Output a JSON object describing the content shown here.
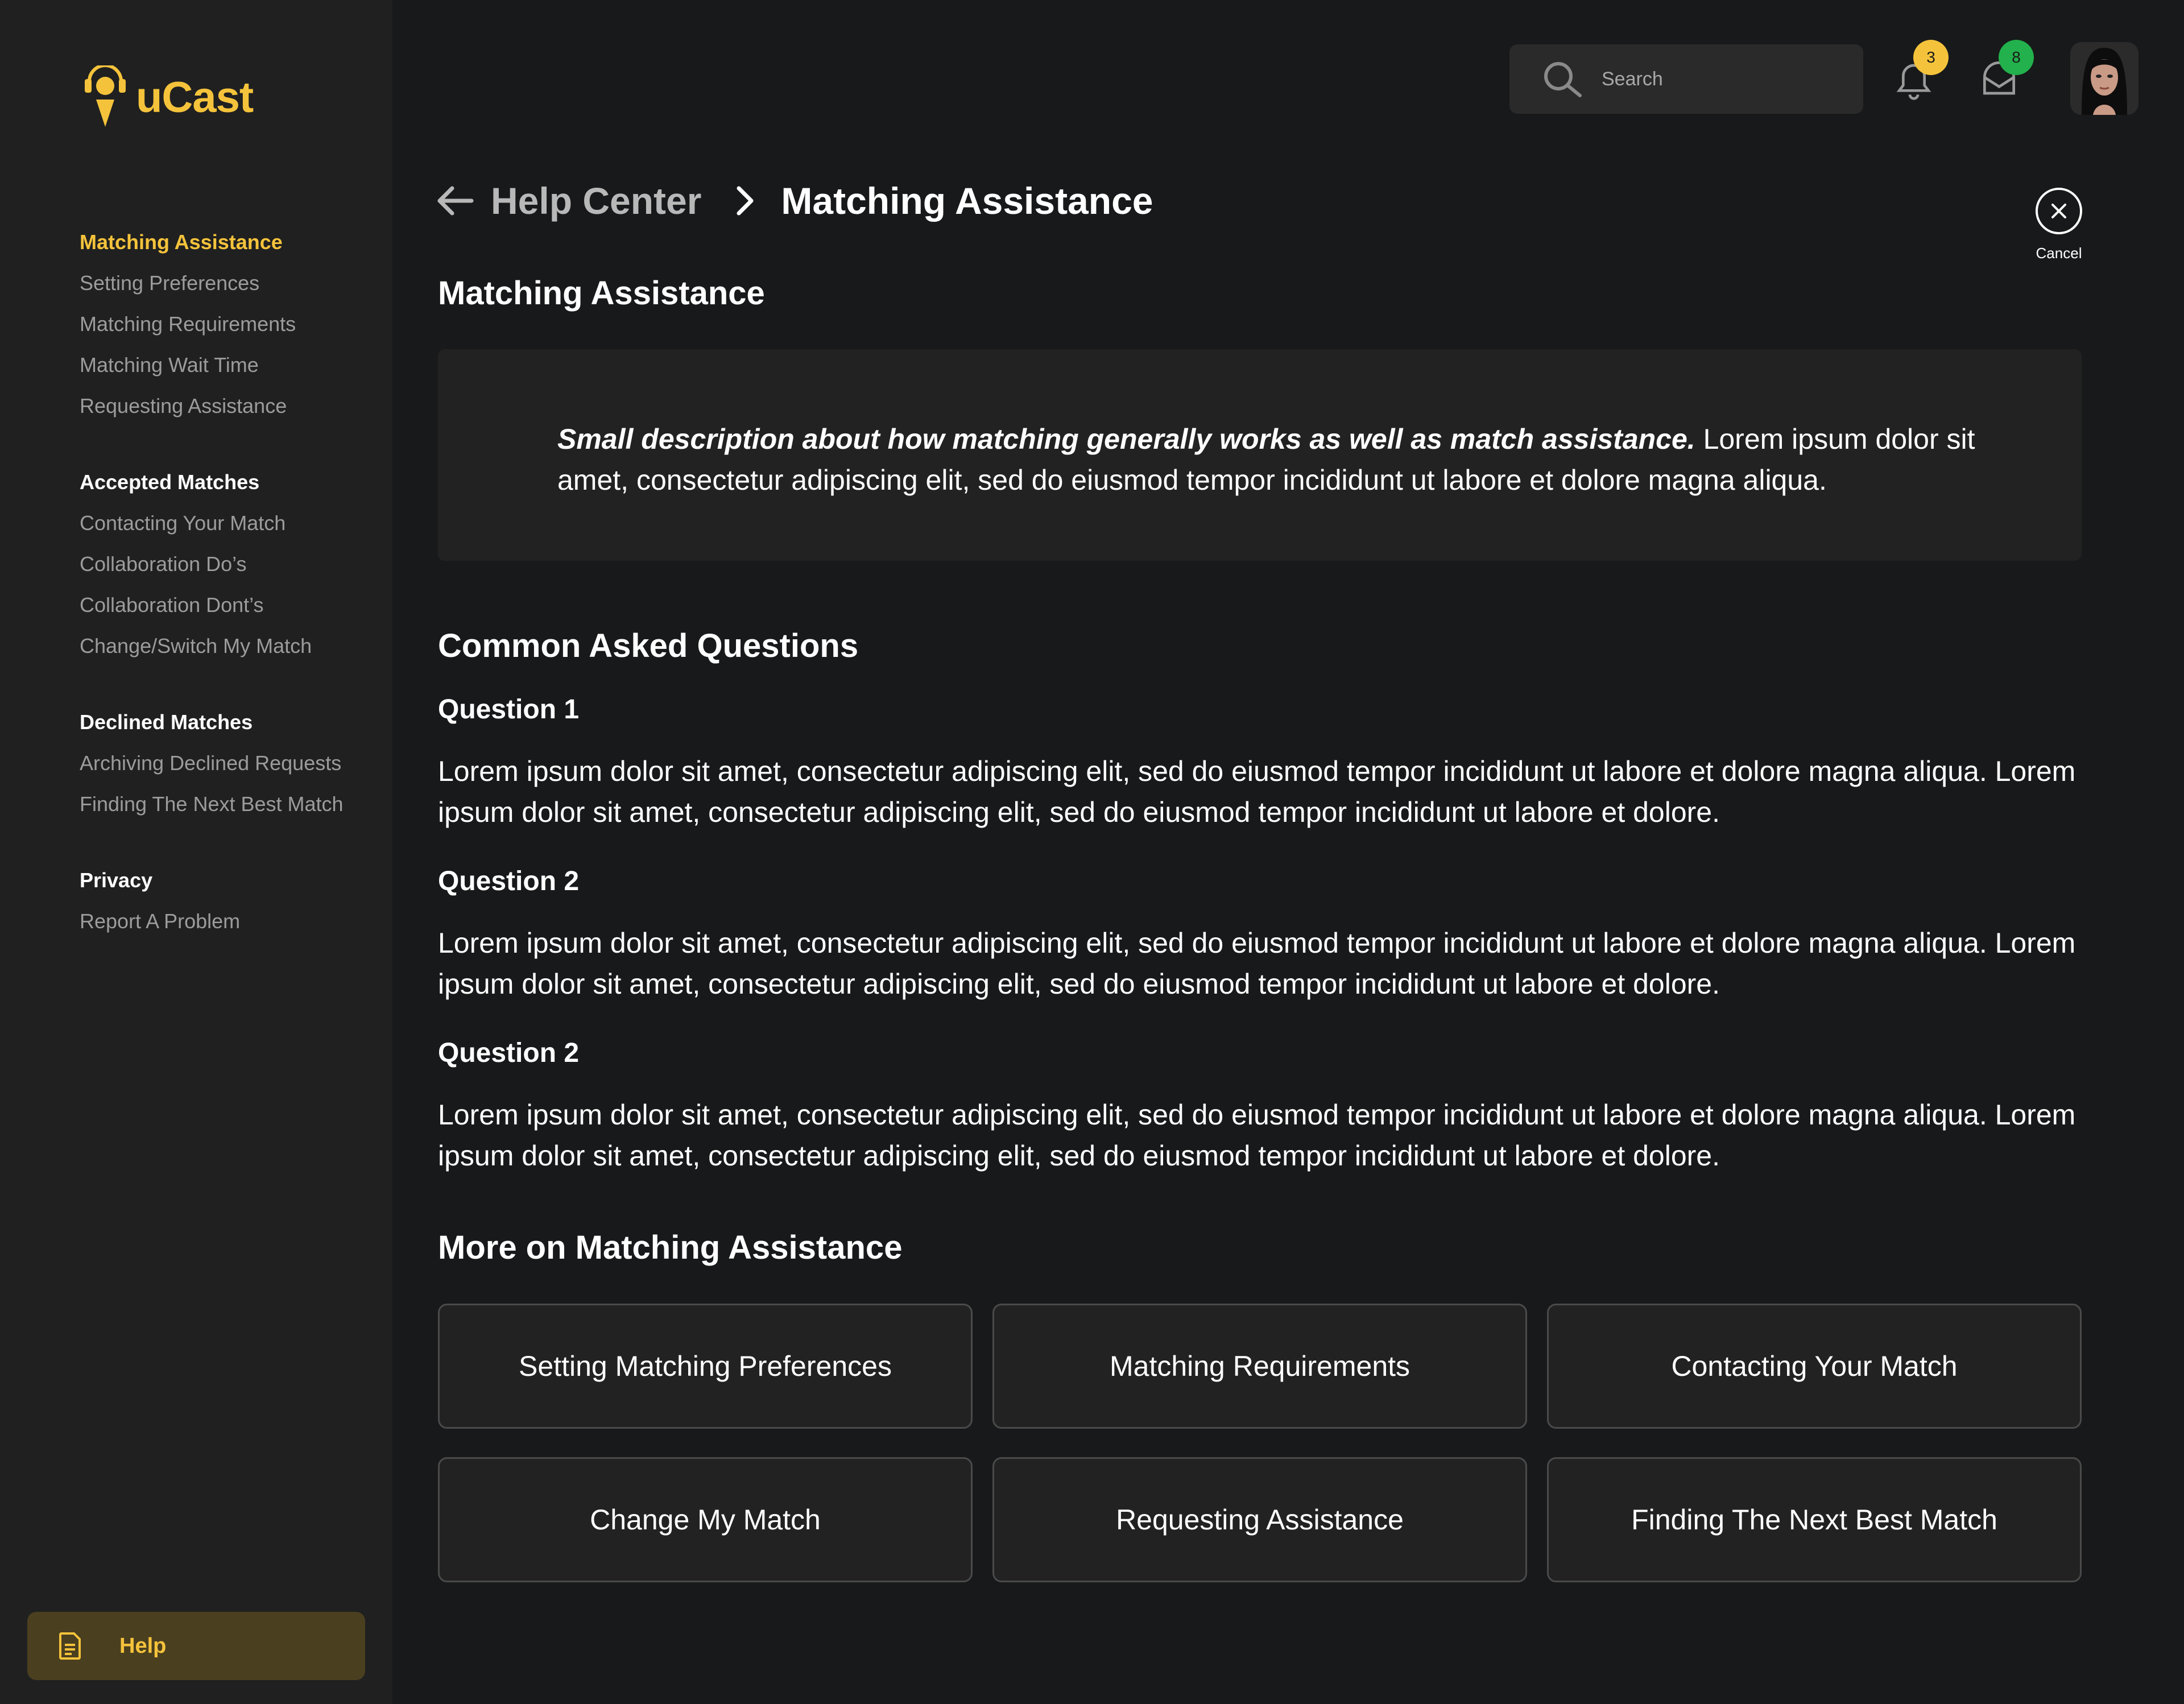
{
  "app": {
    "name": "uCast"
  },
  "sidebar": {
    "groups": [
      {
        "heading": "Matching Assistance",
        "active": true,
        "items": [
          "Setting Preferences",
          "Matching Requirements",
          "Matching Wait Time",
          "Requesting Assistance"
        ]
      },
      {
        "heading": "Accepted Matches",
        "active": false,
        "items": [
          "Contacting Your Match",
          "Collaboration Do’s",
          "Collaboration Dont’s",
          "Change/Switch My Match"
        ]
      },
      {
        "heading": "Declined Matches",
        "active": false,
        "items": [
          "Archiving Declined Requests",
          "Finding The Next Best Match"
        ]
      },
      {
        "heading": "Privacy",
        "active": false,
        "items": [
          "Report A Problem"
        ]
      }
    ],
    "help_label": "Help"
  },
  "topbar": {
    "search_placeholder": "Search",
    "notifications_count": "3",
    "messages_count": "8"
  },
  "breadcrumb": {
    "parent": "Help Center",
    "current": "Matching Assistance"
  },
  "cancel_label": "Cancel",
  "main": {
    "title": "Matching Assistance",
    "description_bold": "Small description about how matching generally works as well as match assistance.",
    "description_rest": " Lorem ipsum dolor sit amet, consectetur adipiscing elit, sed do eiusmod tempor incididunt ut labore et dolore magna aliqua.",
    "faq_title": "Common Asked Questions",
    "questions": [
      {
        "title": "Question 1",
        "body": " Lorem ipsum dolor sit amet, consectetur adipiscing elit, sed do eiusmod tempor incididunt ut labore et dolore magna aliqua. Lorem ipsum dolor sit amet, consectetur adipiscing elit, sed do eiusmod tempor incididunt ut labore et dolore."
      },
      {
        "title": "Question  2",
        "body": " Lorem ipsum dolor sit amet, consectetur adipiscing elit, sed do eiusmod tempor incididunt ut labore et dolore magna aliqua. Lorem ipsum dolor sit amet, consectetur adipiscing elit, sed do eiusmod tempor incididunt ut labore et dolore."
      },
      {
        "title": "Question  2",
        "body": " Lorem ipsum dolor sit amet, consectetur adipiscing elit, sed do eiusmod tempor incididunt ut labore et dolore magna aliqua. Lorem ipsum dolor sit amet, consectetur adipiscing elit, sed do eiusmod tempor incididunt ut labore et dolore."
      }
    ],
    "more_title": "More on Matching Assistance",
    "more_links": [
      "Setting Matching Preferences",
      "Matching Requirements",
      "Contacting Your Match",
      "Change My Match",
      "Requesting Assistance",
      "Finding The Next Best Match"
    ]
  },
  "colors": {
    "accent": "#f5c33b",
    "notification_badge": "#f5c33b",
    "message_badge": "#22b14c",
    "background": "#18191a",
    "sidebar": "#202020"
  }
}
